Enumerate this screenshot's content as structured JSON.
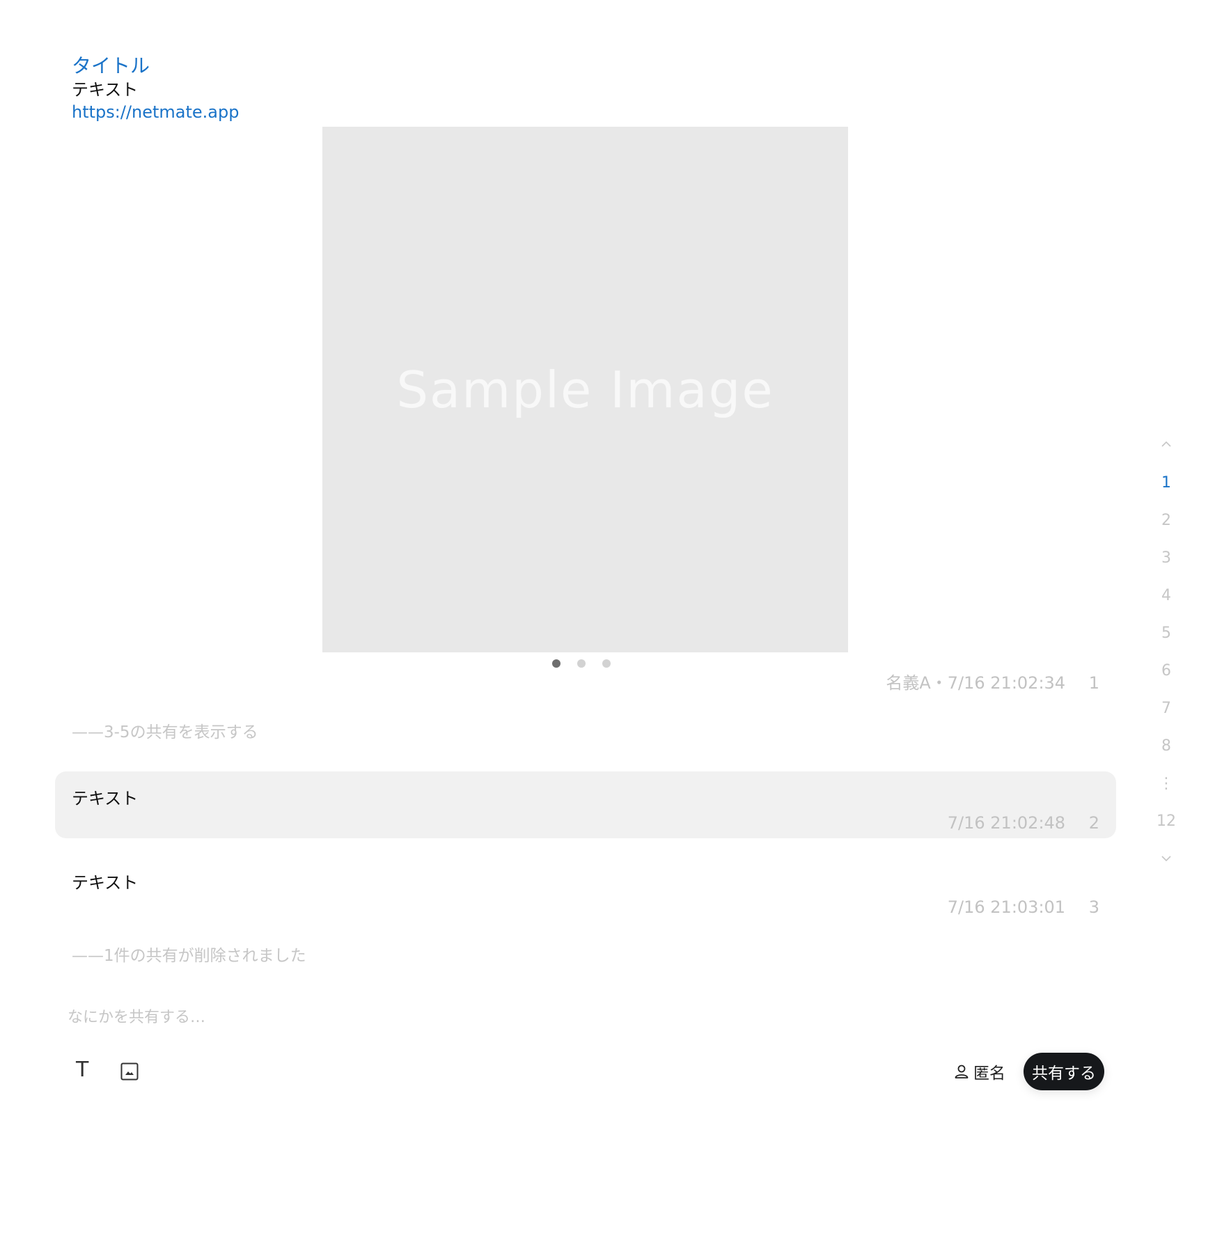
{
  "header": {
    "title": "タイトル",
    "text": "テキスト",
    "link": "https://netmate.app"
  },
  "media": {
    "image_label": "Sample Image",
    "slides_count": 3,
    "active_slide": 1
  },
  "first_post_meta": {
    "author_time": "名義A・7/16 21:02:34",
    "number": "1"
  },
  "notices": {
    "hidden": "——3-5の共有を表示する",
    "deleted": "——1件の共有が削除されました"
  },
  "posts": [
    {
      "text": "テキスト",
      "time": "7/16 21:02:48",
      "number": "2"
    },
    {
      "text": "テキスト",
      "time": "7/16 21:03:01",
      "number": "3"
    }
  ],
  "composer": {
    "placeholder": "なにかを共有する…",
    "text_tool": "T",
    "anonymous_label": "匿名",
    "share_label": "共有する"
  },
  "pager": {
    "pages": [
      "1",
      "2",
      "3",
      "4",
      "5",
      "6",
      "7",
      "8",
      "⋮",
      "12"
    ],
    "active": "1"
  },
  "colors": {
    "accent": "#1a73c8",
    "muted": "#c2c2c2",
    "highlight_bg": "#f1f1f1",
    "button_bg": "#16181b"
  },
  "icons": {
    "pager_up": "chevron-up-icon",
    "pager_down": "chevron-down-icon",
    "text_tool": "text-icon",
    "image_tool": "image-icon",
    "anonymous": "person-icon"
  }
}
